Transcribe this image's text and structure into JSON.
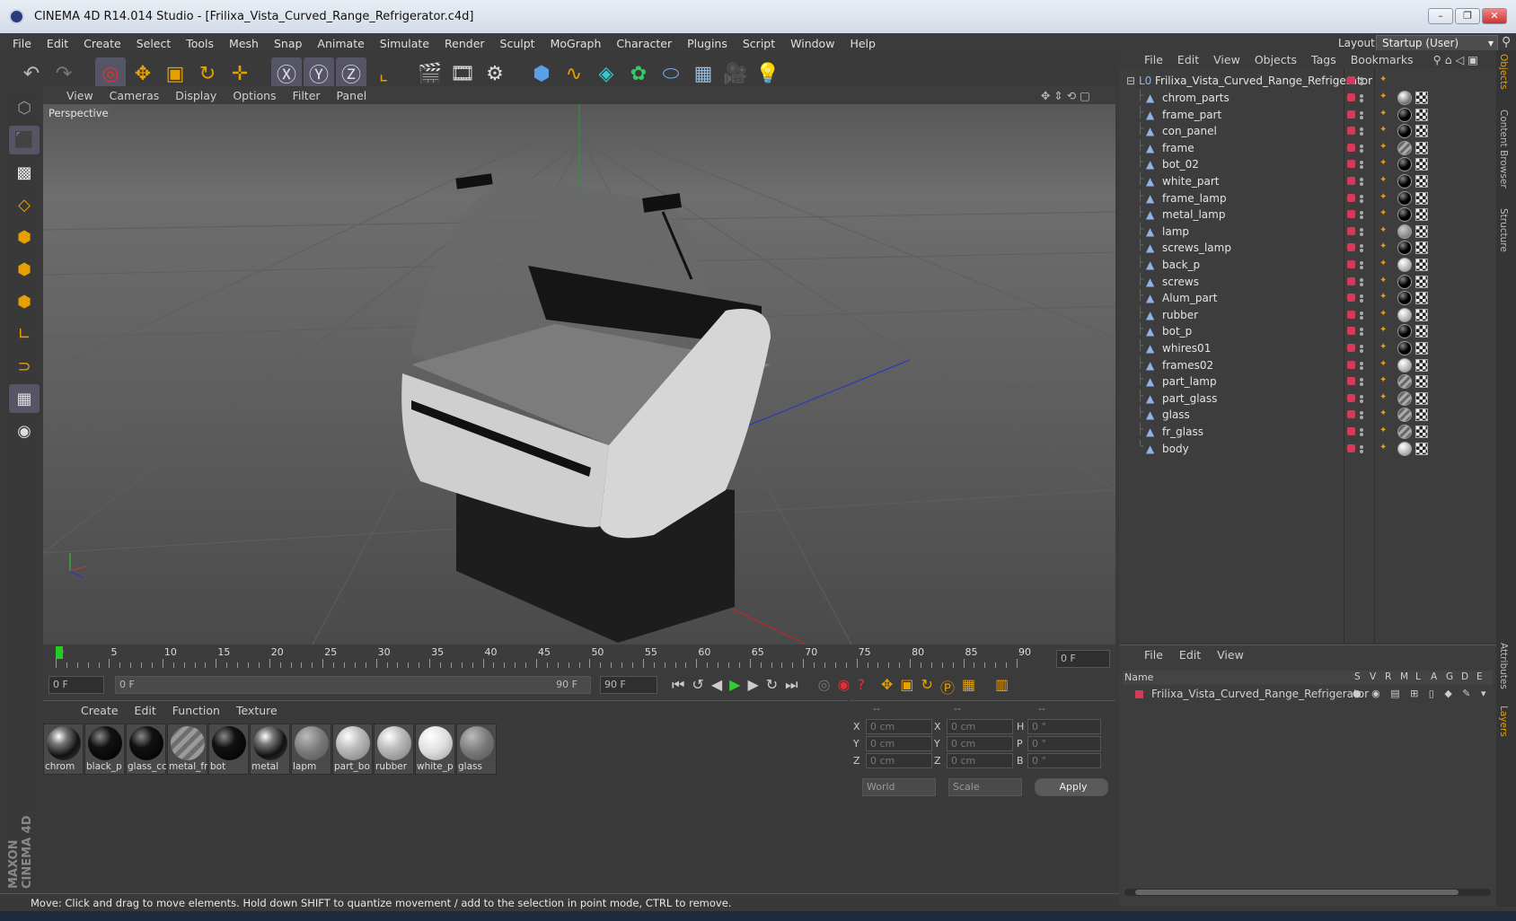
{
  "window": {
    "title": "CINEMA 4D R14.014 Studio - [Frilixa_Vista_Curved_Range_Refrigerator.c4d]",
    "buttons": [
      "–",
      "❐",
      "✕"
    ]
  },
  "menubar": {
    "items": [
      "File",
      "Edit",
      "Create",
      "Select",
      "Tools",
      "Mesh",
      "Snap",
      "Animate",
      "Simulate",
      "Render",
      "Sculpt",
      "MoGraph",
      "Character",
      "Plugins",
      "Script",
      "Window",
      "Help"
    ],
    "layout_label": "Layout:",
    "layout_value": "Startup (User)"
  },
  "viewport": {
    "menu": [
      "View",
      "Cameras",
      "Display",
      "Options",
      "Filter",
      "Panel"
    ],
    "label": "Perspective",
    "accent": "#e8a000"
  },
  "timeline": {
    "ticks": [
      "0",
      "5",
      "10",
      "15",
      "20",
      "25",
      "30",
      "35",
      "40",
      "45",
      "50",
      "55",
      "60",
      "65",
      "70",
      "75",
      "80",
      "85",
      "90"
    ],
    "frame_field": "0 F",
    "start_field": "0 F",
    "range_left": "0 F",
    "range_right": "90 F",
    "end_field": "90 F"
  },
  "materials": {
    "menu": [
      "Create",
      "Edit",
      "Function",
      "Texture"
    ],
    "items": [
      {
        "label": "chrom",
        "kind": "chrome"
      },
      {
        "label": "black_p",
        "kind": "black"
      },
      {
        "label": "glass_cc",
        "kind": "black"
      },
      {
        "label": "metal_fr",
        "kind": "stripe"
      },
      {
        "label": "bot",
        "kind": "black"
      },
      {
        "label": "metal",
        "kind": "chrome"
      },
      {
        "label": "lapm",
        "kind": "grey"
      },
      {
        "label": "part_bo",
        "kind": "light"
      },
      {
        "label": "rubber",
        "kind": "light"
      },
      {
        "label": "white_p",
        "kind": "white"
      },
      {
        "label": "glass",
        "kind": "grey"
      }
    ]
  },
  "coords": {
    "headers": [
      "--",
      "--",
      "--"
    ],
    "rows": [
      {
        "a": "X",
        "av": "0 cm",
        "b": "X",
        "bv": "0 cm",
        "c": "H",
        "cv": "0 °"
      },
      {
        "a": "Y",
        "av": "0 cm",
        "b": "Y",
        "bv": "0 cm",
        "c": "P",
        "cv": "0 °"
      },
      {
        "a": "Z",
        "av": "0 cm",
        "b": "Z",
        "bv": "0 cm",
        "c": "B",
        "cv": "0 °"
      }
    ],
    "mode1": "World",
    "mode2": "Scale",
    "apply": "Apply"
  },
  "objects": {
    "menu": [
      "File",
      "Edit",
      "View",
      "Objects",
      "Tags",
      "Bookmarks"
    ],
    "root": "Frilixa_Vista_Curved_Range_Refrigerator",
    "items": [
      "chrom_parts",
      "frame_part",
      "con_panel",
      "frame",
      "bot_02",
      "white_part",
      "frame_lamp",
      "metal_lamp",
      "lamp",
      "screws_lamp",
      "back_p",
      "screws",
      "Alum_part",
      "rubber",
      "bot_p",
      "whires01",
      "frames02",
      "part_lamp",
      "part_glass",
      "glass",
      "fr_glass",
      "body"
    ]
  },
  "layers": {
    "menu": [
      "File",
      "Edit",
      "View"
    ],
    "name_header": "Name",
    "cols": [
      "S",
      "V",
      "R",
      "M",
      "L",
      "A",
      "G",
      "D",
      "E"
    ],
    "item": "Frilixa_Vista_Curved_Range_Refrigerator"
  },
  "sidetabs": [
    "Objects",
    "Content Browser",
    "Structure",
    "Attributes",
    "Layers"
  ],
  "status": "Move: Click and drag to move elements. Hold down SHIFT to quantize movement / add to the selection in point mode, CTRL to remove.",
  "brand": "MAXON CINEMA 4D"
}
